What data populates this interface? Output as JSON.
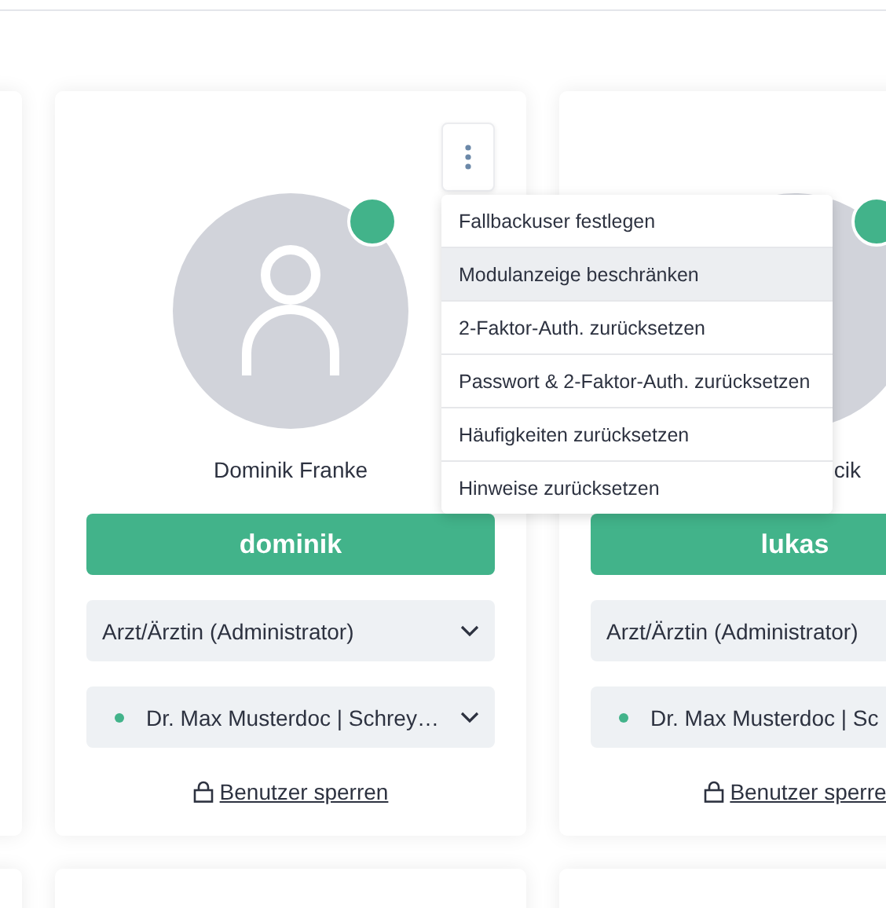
{
  "cards": [
    {
      "name": "Dominik Franke",
      "username": "dominik",
      "role": "Arzt/Ärztin (Administrator)",
      "practice": "Dr. Max Musterdoc | Schrey…",
      "lock_label": "Benutzer sperren",
      "online": true,
      "menu": [
        {
          "label": "Fallbackuser festlegen",
          "highlighted": false
        },
        {
          "label": "Modulanzeige beschränken",
          "highlighted": true
        },
        {
          "label": "2-Faktor-Auth. zurücksetzen",
          "highlighted": false
        },
        {
          "label": "Passwort & 2-Faktor-Auth. zurücksetzen",
          "highlighted": false
        },
        {
          "label": "Häufigkeiten zurücksetzen",
          "highlighted": false
        },
        {
          "label": "Hinweise zurücksetzen",
          "highlighted": false
        }
      ]
    },
    {
      "name": "cik",
      "username": "lukas",
      "role": "Arzt/Ärztin (Administrator)",
      "practice": "Dr. Max Musterdoc | Sc",
      "lock_label": "Benutzer sperre",
      "online": true
    }
  ]
}
